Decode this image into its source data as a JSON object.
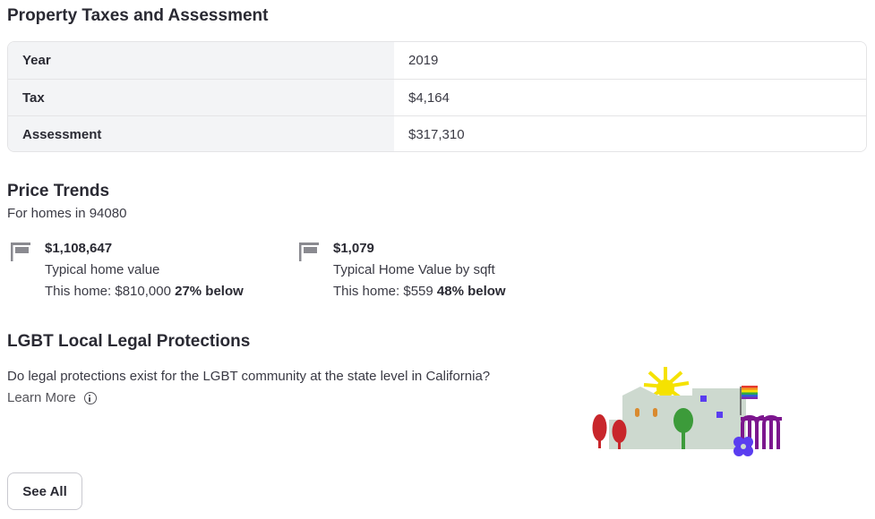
{
  "tax_section": {
    "title": "Property Taxes and Assessment",
    "rows": [
      {
        "label": "Year",
        "value": "2019"
      },
      {
        "label": "Tax",
        "value": "$4,164"
      },
      {
        "label": "Assessment",
        "value": "$317,310"
      }
    ]
  },
  "price_trends": {
    "title": "Price Trends",
    "subtitle": "For homes in 94080",
    "items": [
      {
        "value": "$1,108,647",
        "label": "Typical home value",
        "this_home_prefix": "This home: $810,000",
        "comparison": "27% below",
        "icon": "flag-icon"
      },
      {
        "value": "$1,079",
        "label": "Typical Home Value by sqft",
        "this_home_prefix": "This home: $559",
        "comparison": "48% below",
        "icon": "flag-icon"
      }
    ]
  },
  "lgbt": {
    "title": "LGBT Local Legal Protections",
    "question": "Do legal protections exist for the LGBT community at the state level in California?",
    "learn_more": "Learn More",
    "icon": "info-icon"
  },
  "see_all_label": "See All",
  "colors": {
    "text": "#2a2a33",
    "label_bg": "#f3f4f6",
    "border": "#e4e4e6",
    "flag_icon": "#8a8a90"
  }
}
